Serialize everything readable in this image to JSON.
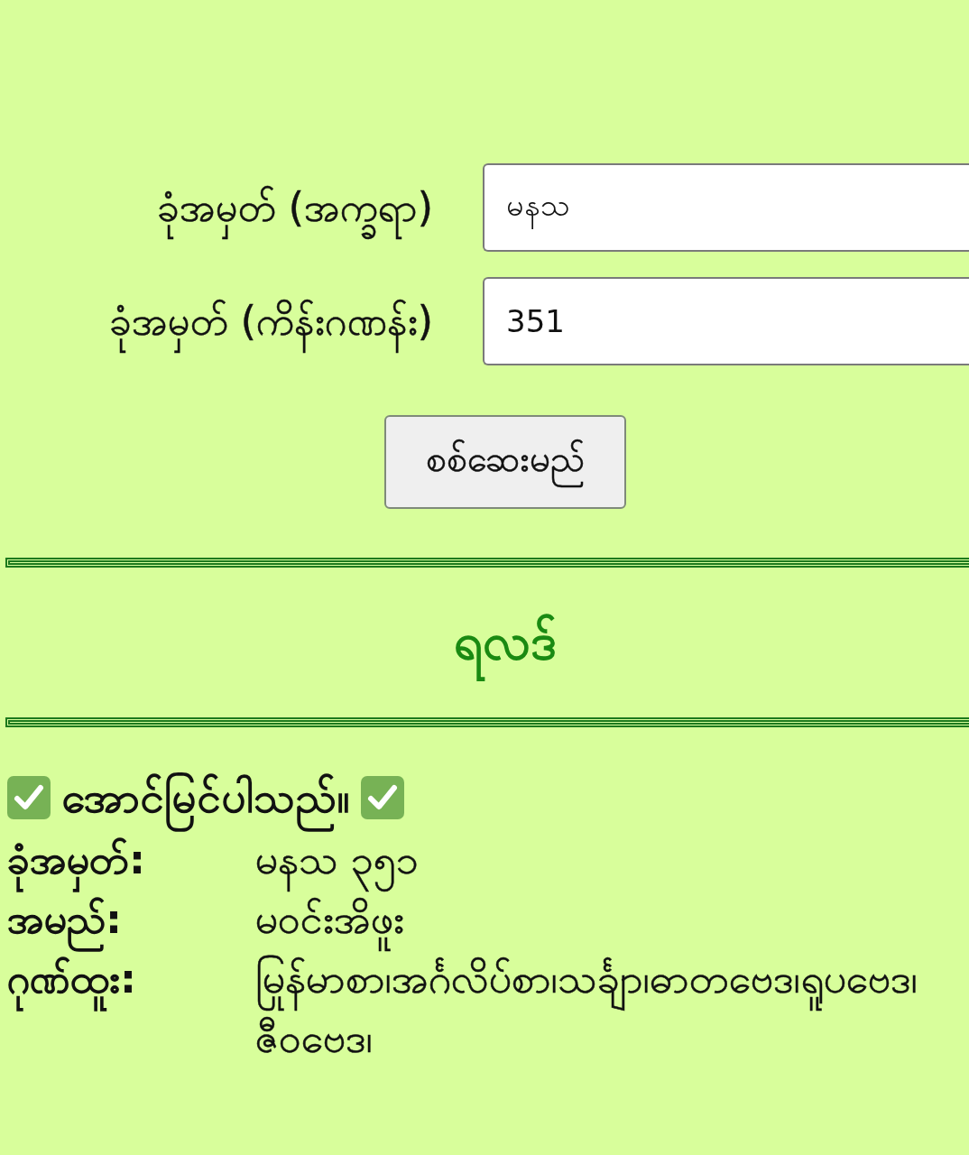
{
  "form": {
    "fields": [
      {
        "label": "ခုံအမှတ် (အက္ခရာ)",
        "value": "မနသ"
      },
      {
        "label": "ခုံအမှတ် (ကိန်းဂဏန်း)",
        "value": "351"
      }
    ],
    "submit_button": "စစ်ဆေးမည်"
  },
  "result": {
    "heading": "ရလဒ်",
    "status": {
      "kind": "success",
      "message": "အောင်မြင်ပါသည်။"
    },
    "rows": [
      {
        "label": "ခုံအမှတ်:",
        "value": "မနသ ၃၅၁"
      },
      {
        "label": "အမည်:",
        "value": "မဝင်းအိဖူး"
      },
      {
        "label": "ဂုဏ်ထူး:",
        "value": "မြန်မာစာ၊အင်္ဂလိပ်စာ၊သင်္ချာ၊ဓာတုဗေဒ၊ရူပဗေဒ၊ဇီဝဗေဒ၊"
      }
    ]
  }
}
